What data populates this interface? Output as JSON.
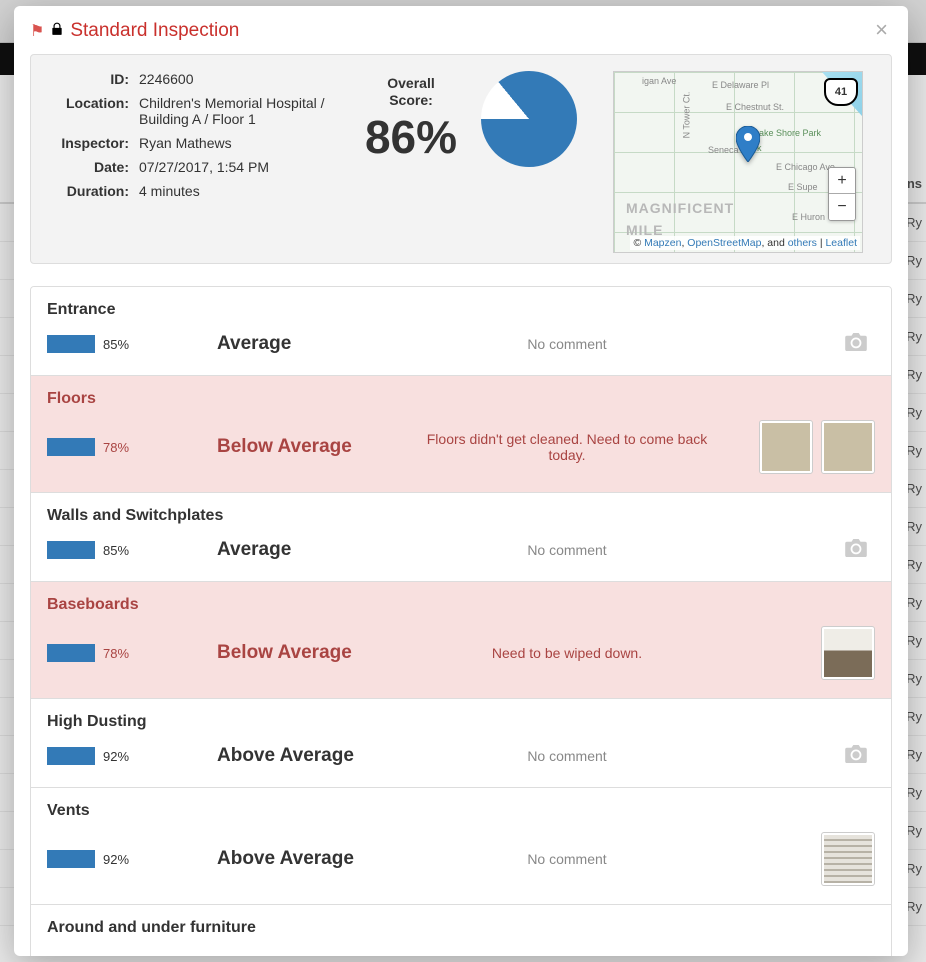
{
  "modal": {
    "title": "Standard Inspection"
  },
  "meta": {
    "id_label": "ID:",
    "id_value": "2246600",
    "location_label": "Location:",
    "location_value": "Children's Memorial Hospital / Building A / Floor 1",
    "inspector_label": "Inspector:",
    "inspector_value": "Ryan Mathews",
    "date_label": "Date:",
    "date_value": "07/27/2017, 1:54 PM",
    "duration_label": "Duration:",
    "duration_value": "4 minutes"
  },
  "score": {
    "caption_l1": "Overall",
    "caption_l2": "Score:",
    "value": "86%"
  },
  "chart_data": {
    "type": "pie",
    "title": "Overall Score",
    "series": [
      {
        "name": "Score",
        "values": [
          86
        ]
      },
      {
        "name": "Remaining",
        "values": [
          14
        ]
      }
    ]
  },
  "map": {
    "streets": {
      "delaware": "E Delaware Pl",
      "chestnut": "E Chestnut St.",
      "seneca": "Seneca",
      "tower": "N Tower Ct.",
      "chicago": "E Chicago Ave.",
      "superior": "E Supe",
      "huron": "E Huron",
      "michigan": "igan Ave",
      "lakeshore": "Lake Shore Park",
      "lspark_break": "rk"
    },
    "magnificent_l1": "MAGNIFICENT",
    "magnificent_l2": "MILE",
    "hwy": "41",
    "zoom_in": "+",
    "zoom_out": "−",
    "attrib": {
      "copyright": "© ",
      "mapzen": "Mapzen",
      "sep1": ", ",
      "osm": "OpenStreetMap",
      "and_text": ", and ",
      "others": "others",
      "pipe": " | ",
      "leaflet": "Leaflet"
    }
  },
  "bg": {
    "col_header": "Ins"
  },
  "bg_rows": [
    "Ry",
    "Ry",
    "Ry",
    "Ry",
    "Ry",
    "Ry",
    "Ry",
    "Ry",
    "Ry",
    "Ry",
    "Ry",
    "Ry",
    "Ry",
    "Ry",
    "Ry",
    "Ry",
    "Ry",
    "Ry",
    "Ry"
  ],
  "sections": [
    {
      "title": "Entrance",
      "pct": "85%",
      "rating": "Average",
      "comment": "No comment",
      "flagged": false,
      "thumbs": [],
      "camera_placeholder": true
    },
    {
      "title": "Floors",
      "pct": "78%",
      "rating": "Below Average",
      "comment": "Floors didn't get cleaned. Need to come back today.",
      "flagged": true,
      "thumbs": [
        "carpet",
        "carpet"
      ],
      "camera_placeholder": false
    },
    {
      "title": "Walls and Switchplates",
      "pct": "85%",
      "rating": "Average",
      "comment": "No comment",
      "flagged": false,
      "thumbs": [],
      "camera_placeholder": true
    },
    {
      "title": "Baseboards",
      "pct": "78%",
      "rating": "Below Average",
      "comment": "Need to be wiped down.",
      "flagged": true,
      "thumbs": [
        "wall"
      ],
      "camera_placeholder": false
    },
    {
      "title": "High Dusting",
      "pct": "92%",
      "rating": "Above Average",
      "comment": "No comment",
      "flagged": false,
      "thumbs": [],
      "camera_placeholder": true
    },
    {
      "title": "Vents",
      "pct": "92%",
      "rating": "Above Average",
      "comment": "No comment",
      "flagged": false,
      "thumbs": [
        "vent"
      ],
      "camera_placeholder": false
    },
    {
      "title": "Around and under furniture",
      "pct": "",
      "rating": "",
      "comment": "",
      "flagged": false,
      "thumbs": [],
      "camera_placeholder": false
    }
  ]
}
